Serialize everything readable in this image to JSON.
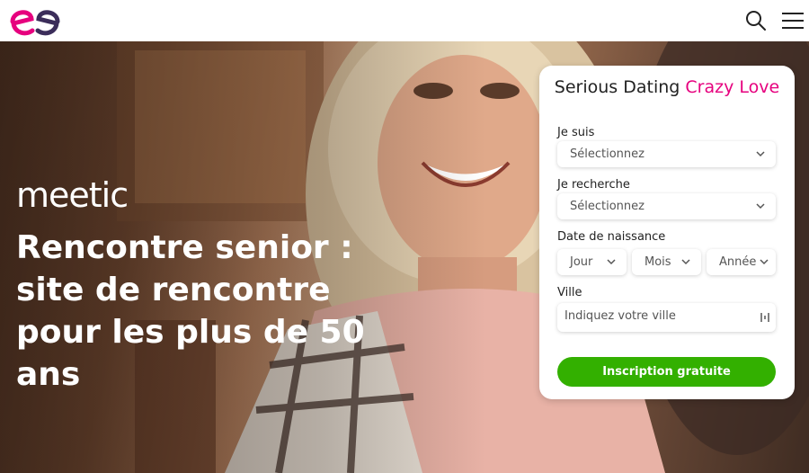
{
  "header": {
    "logo_icon": "meetic-heart-logo-icon",
    "search_icon": "search-icon",
    "menu_icon": "hamburger-menu-icon"
  },
  "hero": {
    "brand": "meetic",
    "title": "Rencontre senior : site de rencontre pour les plus de 50 ans"
  },
  "form": {
    "title_main": "Serious Dating",
    "title_accent": "Crazy Love",
    "accent_color": "#e6007e",
    "i_am": {
      "label": "Je suis",
      "value": "Sélectionnez"
    },
    "looking_for": {
      "label": "Je recherche",
      "value": "Sélectionnez"
    },
    "birthdate": {
      "label": "Date de naissance",
      "day": "Jour",
      "month": "Mois",
      "year": "Année"
    },
    "city": {
      "label": "Ville",
      "placeholder": "Indiquez votre ville",
      "icon": "location-icon"
    },
    "submit_label": "Inscription gratuite",
    "submit_color": "#33b000"
  }
}
